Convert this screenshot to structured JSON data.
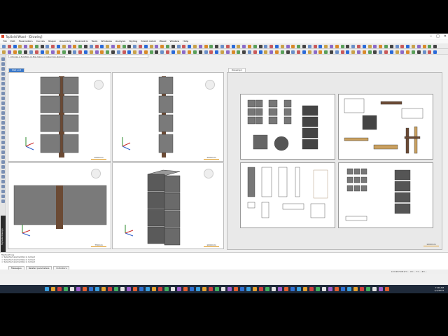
{
  "window": {
    "title": "TopSolid'Wood - [Drawing]",
    "minimize": "─",
    "maximize": "□",
    "close": "✕"
  },
  "menu": [
    "File",
    "Edit",
    "Parameters",
    "Curves",
    "Shape",
    "Assembly",
    "Parametric",
    "Tools",
    "Windows",
    "Analysis",
    "Styling",
    "Sheet metal",
    "Wood",
    "Window",
    "Help"
  ],
  "info_text": "Choose a function in the menu or select an element",
  "tabs": {
    "left": "Wall unit",
    "right": "Drawing 1"
  },
  "views": {
    "scale_a": "1000mm",
    "scale_b": "1000mm",
    "scale_c": "750mm",
    "scale_d": "1000mm",
    "scale_e": "1000mm"
  },
  "vertical_label": "TopSolid Design",
  "command": {
    "header": "TopSolid log",
    "lines": [
      "> Selected element(s) is locked",
      "> Selected element(s) is locked",
      "> Selected element(s) is locked"
    ]
  },
  "bottom_tabs": [
    "Messages",
    "Related parameters",
    "Indicators"
  ],
  "status": {
    "left": "",
    "right": "LX=437.98   LY=...   X=...   Y=...   Z=..."
  },
  "tray": {
    "time": "7:00 AM",
    "date": "1/1/2024"
  },
  "colors": {
    "accent": "#3a78c9",
    "wood": "#6b4a34",
    "panel": "#7a7a7a",
    "taskbar": "#1f2a3a"
  }
}
